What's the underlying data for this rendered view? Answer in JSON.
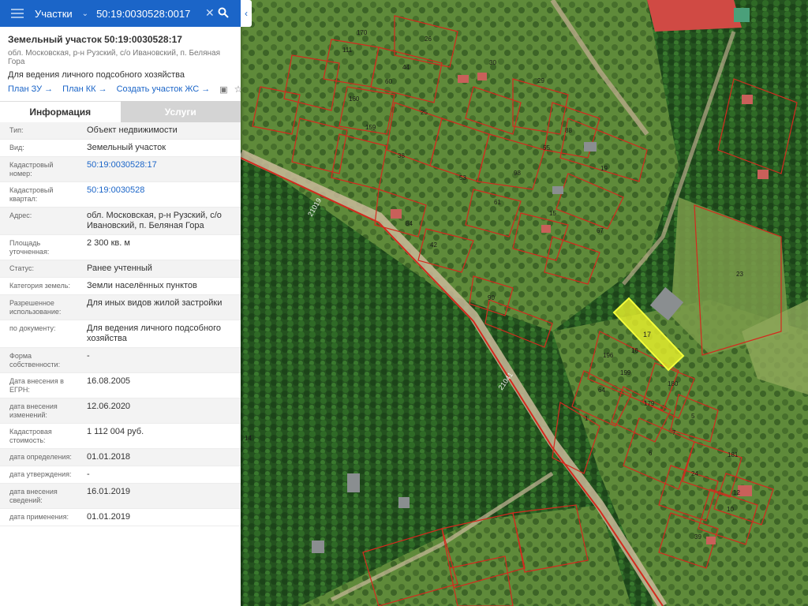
{
  "search": {
    "section_label": "Участки",
    "query": "50:19:0030528:0017"
  },
  "parcel": {
    "title": "Земельный участок 50:19:0030528:17",
    "address": "обл. Московская, р-н Рузский, с/о Ивановский, п. Беляная Гора",
    "permitted_use": "Для ведения личного подсобного хозяйства"
  },
  "links": {
    "plan_zu": "План ЗУ",
    "plan_kk": "План КК",
    "create_zs": "Создать участок ЖС"
  },
  "tabs": {
    "info": "Информация",
    "services": "Услуги"
  },
  "fields": [
    {
      "label": "Тип:",
      "value": "Объект недвижимости",
      "link": false
    },
    {
      "label": "Вид:",
      "value": "Земельный участок",
      "link": false
    },
    {
      "label": "Кадастровый номер:",
      "value": "50:19:0030528:17",
      "link": true
    },
    {
      "label": "Кадастровый квартал:",
      "value": "50:19:0030528",
      "link": true
    },
    {
      "label": "Адрес:",
      "value": "обл. Московская, р-н Рузский, с/о Ивановский, п. Беляная Гора",
      "link": false
    },
    {
      "label": "Площадь уточненная:",
      "value": "2 300 кв. м",
      "link": false
    },
    {
      "label": "Статус:",
      "value": "Ранее учтенный",
      "link": false
    },
    {
      "label": "Категория земель:",
      "value": "Земли населённых пунктов",
      "link": false
    },
    {
      "label": "Разрешенное использование:",
      "value": "Для иных видов жилой застройки",
      "link": false
    },
    {
      "label": "по документу:",
      "value": "Для ведения личного подсобного хозяйства",
      "link": false
    },
    {
      "label": "Форма собственности:",
      "value": "-",
      "link": false
    },
    {
      "label": "Дата внесения в ЕГРН:",
      "value": "16.08.2005",
      "link": false
    },
    {
      "label": "дата внесения изменений:",
      "value": "12.06.2020",
      "link": false
    },
    {
      "label": "Кадастровая стоимость:",
      "value": "1 112 004 руб.",
      "link": false
    },
    {
      "label": "дата определения:",
      "value": "01.01.2018",
      "link": false
    },
    {
      "label": "дата утверждения:",
      "value": "-",
      "link": false
    },
    {
      "label": "дата внесения сведений:",
      "value": "16.01.2019",
      "link": false
    },
    {
      "label": "дата применения:",
      "value": "01.01.2019",
      "link": false
    }
  ],
  "map": {
    "road_labels": [
      "21019",
      "21041"
    ],
    "selected_parcel_label": "17",
    "parcel_labels": [
      "26",
      "44",
      "111",
      "160",
      "159",
      "60",
      "38",
      "25",
      "53",
      "98",
      "61",
      "42",
      "90",
      "19",
      "67",
      "15",
      "16",
      "196",
      "199",
      "180",
      "179",
      "64",
      "5",
      "7",
      "6",
      "181",
      "24",
      "12",
      "10",
      "39",
      "23",
      "14",
      "30",
      "29",
      "88",
      "55",
      "84",
      "170",
      "1"
    ],
    "colors": {
      "selected_fill": "#e8f02a",
      "boundary": "#d42a1e",
      "forest": "#1f4a1c"
    }
  }
}
